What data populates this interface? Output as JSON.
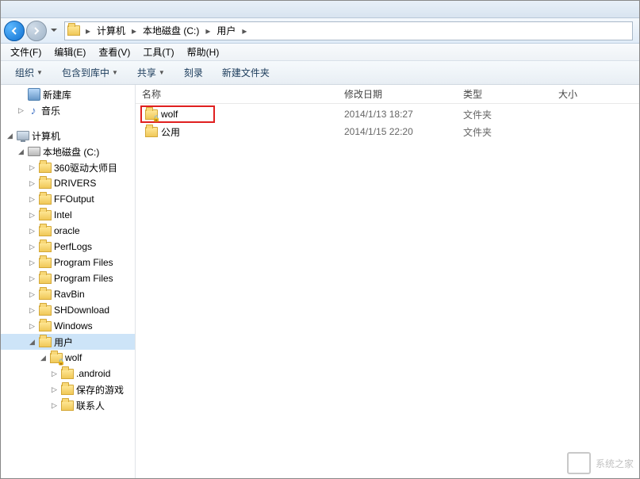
{
  "breadcrumbs": [
    "计算机",
    "本地磁盘 (C:)",
    "用户"
  ],
  "menus": [
    {
      "label": "文件(F)"
    },
    {
      "label": "编辑(E)"
    },
    {
      "label": "查看(V)"
    },
    {
      "label": "工具(T)"
    },
    {
      "label": "帮助(H)"
    }
  ],
  "tools": {
    "organize": "组织",
    "include": "包含到库中",
    "share": "共享",
    "burn": "刻录",
    "newfolder": "新建文件夹"
  },
  "columns": {
    "name": "名称",
    "date": "修改日期",
    "type": "类型",
    "size": "大小"
  },
  "files": [
    {
      "name": "wolf",
      "date": "2014/1/13 18:27",
      "type": "文件夹",
      "highlighted": true
    },
    {
      "name": "公用",
      "date": "2014/1/15 22:20",
      "type": "文件夹",
      "highlighted": false
    }
  ],
  "tree": {
    "newlib": "新建库",
    "music": "音乐",
    "computer": "计算机",
    "cdrive": "本地磁盘 (C:)",
    "folders": [
      "360驱动大师目",
      "DRIVERS",
      "FFOutput",
      "Intel",
      "oracle",
      "PerfLogs",
      "Program Files",
      "Program Files",
      "RavBin",
      "SHDownload",
      "Windows"
    ],
    "users": "用户",
    "wolf": "wolf",
    "wolf_children": [
      ".android",
      "保存的游戏",
      "联系人"
    ]
  },
  "watermark": "系统之家"
}
